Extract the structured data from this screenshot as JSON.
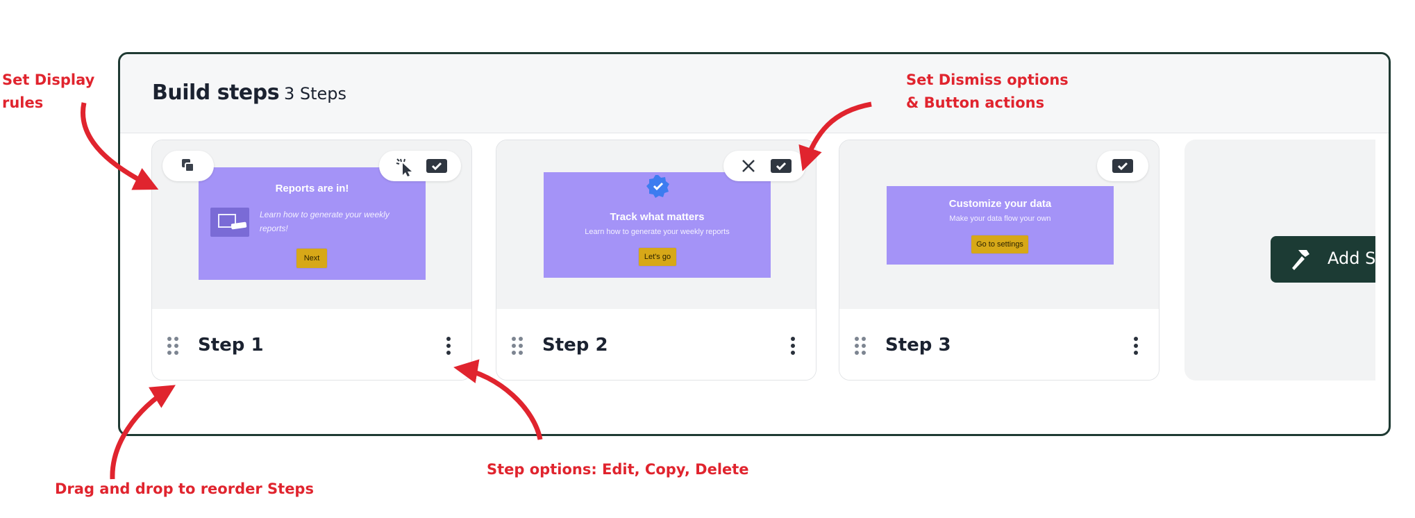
{
  "header": {
    "title": "Build steps",
    "step_count": "3 Steps"
  },
  "steps": [
    {
      "label": "Step 1",
      "modal": {
        "title": "Reports are in!",
        "body": "Learn how to generate your weekly reports!",
        "button": "Next"
      },
      "icons": [
        "copy-icon",
        "cursor-click-icon",
        "checkbox-icon"
      ]
    },
    {
      "label": "Step 2",
      "modal": {
        "title": "Track what matters",
        "body": "Learn how to generate your weekly reports",
        "button": "Let's go"
      },
      "icons": [
        "close-icon",
        "checkbox-icon",
        "verified-badge-icon"
      ]
    },
    {
      "label": "Step 3",
      "modal": {
        "title": "Customize your data",
        "body": "Make your data flow your own",
        "button": "Go to settings"
      },
      "icons": [
        "checkbox-icon"
      ]
    }
  ],
  "add_step": {
    "label": "Add Step",
    "icon": "hammer-icon"
  },
  "annotations": {
    "display_rules": [
      "Set Display",
      "rules"
    ],
    "dismiss_options": [
      "Set Dismiss options",
      "& Button actions"
    ],
    "drag_reorder": "Drag and drop to reorder Steps",
    "step_options": "Step options: Edit, Copy, Delete"
  },
  "colors": {
    "modal_bg": "#a493f7",
    "modal_button": "#d7a818",
    "panel_border": "#1f3a33",
    "add_button_bg": "#1c3b34",
    "annotation_red": "#e0242e",
    "verified_badge": "#3d7cf0"
  }
}
